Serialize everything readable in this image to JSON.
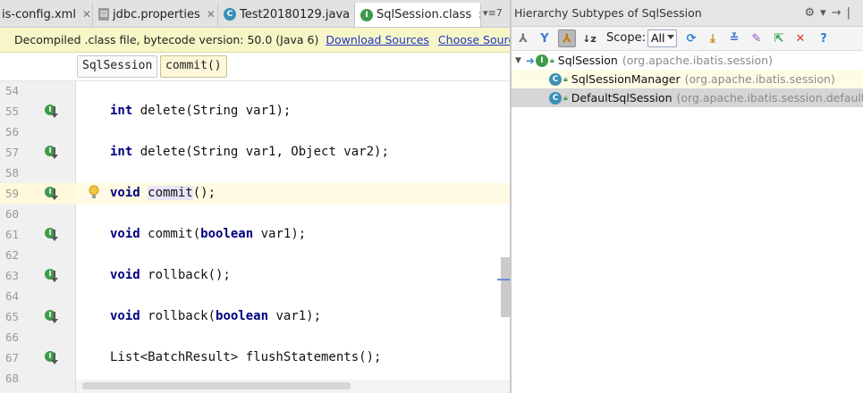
{
  "editor_tabs": [
    {
      "label": "is-config.xml",
      "icon": "xml-file-icon",
      "active": false
    },
    {
      "label": "jdbc.properties",
      "icon": "properties-file-icon",
      "active": false
    },
    {
      "label": "Test20180129.java",
      "icon": "java-class-icon",
      "active": false
    },
    {
      "label": "SqlSession.class",
      "icon": "interface-class-icon",
      "active": true
    }
  ],
  "tab_overflow": "▾≡7",
  "banner": {
    "text": "Decompiled .class file, bytecode version: 50.0 (Java 6)",
    "link_download": "Download Sources",
    "link_choose": "Choose Sources..."
  },
  "breadcrumbs": [
    "SqlSession",
    "commit()"
  ],
  "code_lines": [
    {
      "num": "54",
      "text": "",
      "marker": false
    },
    {
      "num": "55",
      "text": "int delete(String var1);",
      "marker": true
    },
    {
      "num": "56",
      "text": "",
      "marker": false
    },
    {
      "num": "57",
      "text": "int delete(String var1, Object var2);",
      "marker": true
    },
    {
      "num": "58",
      "text": "",
      "marker": false
    },
    {
      "num": "59",
      "text": "void commit();",
      "marker": true
    },
    {
      "num": "60",
      "text": "",
      "marker": false
    },
    {
      "num": "61",
      "text": "void commit(boolean var1);",
      "marker": true
    },
    {
      "num": "62",
      "text": "",
      "marker": false
    },
    {
      "num": "63",
      "text": "void rollback();",
      "marker": true
    },
    {
      "num": "64",
      "text": "",
      "marker": false
    },
    {
      "num": "65",
      "text": "void rollback(boolean var1);",
      "marker": true
    },
    {
      "num": "66",
      "text": "",
      "marker": false
    },
    {
      "num": "67",
      "text": "List<BatchResult> flushStatements();",
      "marker": true
    },
    {
      "num": "68",
      "text": "",
      "marker": false
    }
  ],
  "hierarchy": {
    "title": "Hierarchy Subtypes of SqlSession",
    "scope_label": "Scope:",
    "scope_value": "All",
    "nodes": [
      {
        "name": "SqlSession",
        "package": "(org.apache.ibatis.session)",
        "kind": "interface",
        "level": 0
      },
      {
        "name": "SqlSessionManager",
        "package": "(org.apache.ibatis.session)",
        "kind": "class",
        "level": 1
      },
      {
        "name": "DefaultSqlSession",
        "package": "(org.apache.ibatis.session.defaults)",
        "kind": "class",
        "level": 1
      }
    ]
  },
  "colors": {
    "keyword": "#000080",
    "gutter_marker": "#3f9b4a",
    "class_icon": "#3a8fb7",
    "banner_bg": "#f6f6c6",
    "link": "#2235c8"
  }
}
